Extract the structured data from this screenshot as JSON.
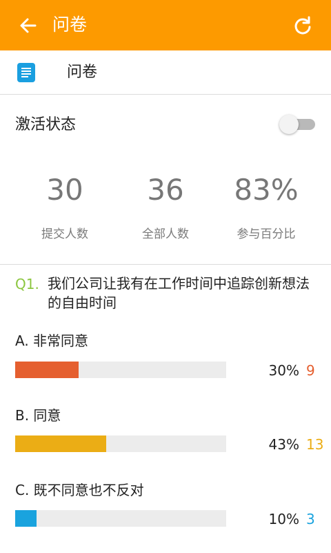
{
  "topbar": {
    "title": "问卷",
    "bg": "#fd9a00"
  },
  "header": {
    "title": "问卷",
    "icon": "document-icon",
    "icon_color": "#1a9fe0"
  },
  "activation": {
    "label": "激活状态",
    "toggle_on": false
  },
  "stats": [
    {
      "value": "30",
      "label": "提交人数"
    },
    {
      "value": "36",
      "label": "全部人数"
    },
    {
      "value": "83%",
      "label": "参与百分比"
    }
  ],
  "question": {
    "number": "Q1.",
    "text": "我们公司让我有在工作时间中追踪创新想法的自由时间",
    "options": [
      {
        "label": "A. 非常同意",
        "percent": 30,
        "percent_text": "30%",
        "count": "9",
        "color": "#e55f2f"
      },
      {
        "label": "B. 同意",
        "percent": 43,
        "percent_text": "43%",
        "count": "13",
        "color": "#ebad15"
      },
      {
        "label": "C. 既不同意也不反对",
        "percent": 10,
        "percent_text": "10%",
        "count": "3",
        "color": "#1aa3de"
      }
    ]
  }
}
